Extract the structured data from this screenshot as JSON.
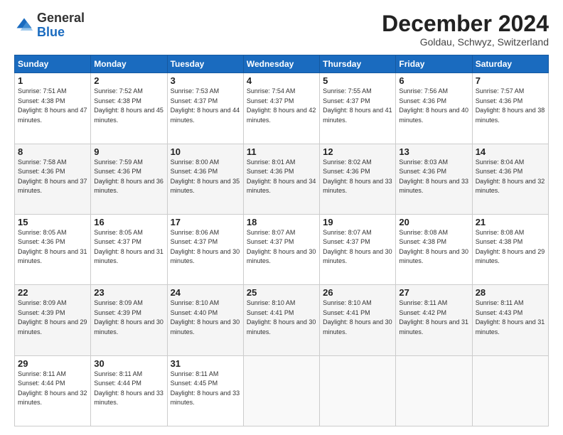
{
  "header": {
    "logo_general": "General",
    "logo_blue": "Blue",
    "main_title": "December 2024",
    "subtitle": "Goldau, Schwyz, Switzerland"
  },
  "days_of_week": [
    "Sunday",
    "Monday",
    "Tuesday",
    "Wednesday",
    "Thursday",
    "Friday",
    "Saturday"
  ],
  "weeks": [
    [
      {
        "day": "1",
        "sunrise": "Sunrise: 7:51 AM",
        "sunset": "Sunset: 4:38 PM",
        "daylight": "Daylight: 8 hours and 47 minutes."
      },
      {
        "day": "2",
        "sunrise": "Sunrise: 7:52 AM",
        "sunset": "Sunset: 4:38 PM",
        "daylight": "Daylight: 8 hours and 45 minutes."
      },
      {
        "day": "3",
        "sunrise": "Sunrise: 7:53 AM",
        "sunset": "Sunset: 4:37 PM",
        "daylight": "Daylight: 8 hours and 44 minutes."
      },
      {
        "day": "4",
        "sunrise": "Sunrise: 7:54 AM",
        "sunset": "Sunset: 4:37 PM",
        "daylight": "Daylight: 8 hours and 42 minutes."
      },
      {
        "day": "5",
        "sunrise": "Sunrise: 7:55 AM",
        "sunset": "Sunset: 4:37 PM",
        "daylight": "Daylight: 8 hours and 41 minutes."
      },
      {
        "day": "6",
        "sunrise": "Sunrise: 7:56 AM",
        "sunset": "Sunset: 4:36 PM",
        "daylight": "Daylight: 8 hours and 40 minutes."
      },
      {
        "day": "7",
        "sunrise": "Sunrise: 7:57 AM",
        "sunset": "Sunset: 4:36 PM",
        "daylight": "Daylight: 8 hours and 38 minutes."
      }
    ],
    [
      {
        "day": "8",
        "sunrise": "Sunrise: 7:58 AM",
        "sunset": "Sunset: 4:36 PM",
        "daylight": "Daylight: 8 hours and 37 minutes."
      },
      {
        "day": "9",
        "sunrise": "Sunrise: 7:59 AM",
        "sunset": "Sunset: 4:36 PM",
        "daylight": "Daylight: 8 hours and 36 minutes."
      },
      {
        "day": "10",
        "sunrise": "Sunrise: 8:00 AM",
        "sunset": "Sunset: 4:36 PM",
        "daylight": "Daylight: 8 hours and 35 minutes."
      },
      {
        "day": "11",
        "sunrise": "Sunrise: 8:01 AM",
        "sunset": "Sunset: 4:36 PM",
        "daylight": "Daylight: 8 hours and 34 minutes."
      },
      {
        "day": "12",
        "sunrise": "Sunrise: 8:02 AM",
        "sunset": "Sunset: 4:36 PM",
        "daylight": "Daylight: 8 hours and 33 minutes."
      },
      {
        "day": "13",
        "sunrise": "Sunrise: 8:03 AM",
        "sunset": "Sunset: 4:36 PM",
        "daylight": "Daylight: 8 hours and 33 minutes."
      },
      {
        "day": "14",
        "sunrise": "Sunrise: 8:04 AM",
        "sunset": "Sunset: 4:36 PM",
        "daylight": "Daylight: 8 hours and 32 minutes."
      }
    ],
    [
      {
        "day": "15",
        "sunrise": "Sunrise: 8:05 AM",
        "sunset": "Sunset: 4:36 PM",
        "daylight": "Daylight: 8 hours and 31 minutes."
      },
      {
        "day": "16",
        "sunrise": "Sunrise: 8:05 AM",
        "sunset": "Sunset: 4:37 PM",
        "daylight": "Daylight: 8 hours and 31 minutes."
      },
      {
        "day": "17",
        "sunrise": "Sunrise: 8:06 AM",
        "sunset": "Sunset: 4:37 PM",
        "daylight": "Daylight: 8 hours and 30 minutes."
      },
      {
        "day": "18",
        "sunrise": "Sunrise: 8:07 AM",
        "sunset": "Sunset: 4:37 PM",
        "daylight": "Daylight: 8 hours and 30 minutes."
      },
      {
        "day": "19",
        "sunrise": "Sunrise: 8:07 AM",
        "sunset": "Sunset: 4:37 PM",
        "daylight": "Daylight: 8 hours and 30 minutes."
      },
      {
        "day": "20",
        "sunrise": "Sunrise: 8:08 AM",
        "sunset": "Sunset: 4:38 PM",
        "daylight": "Daylight: 8 hours and 30 minutes."
      },
      {
        "day": "21",
        "sunrise": "Sunrise: 8:08 AM",
        "sunset": "Sunset: 4:38 PM",
        "daylight": "Daylight: 8 hours and 29 minutes."
      }
    ],
    [
      {
        "day": "22",
        "sunrise": "Sunrise: 8:09 AM",
        "sunset": "Sunset: 4:39 PM",
        "daylight": "Daylight: 8 hours and 29 minutes."
      },
      {
        "day": "23",
        "sunrise": "Sunrise: 8:09 AM",
        "sunset": "Sunset: 4:39 PM",
        "daylight": "Daylight: 8 hours and 30 minutes."
      },
      {
        "day": "24",
        "sunrise": "Sunrise: 8:10 AM",
        "sunset": "Sunset: 4:40 PM",
        "daylight": "Daylight: 8 hours and 30 minutes."
      },
      {
        "day": "25",
        "sunrise": "Sunrise: 8:10 AM",
        "sunset": "Sunset: 4:41 PM",
        "daylight": "Daylight: 8 hours and 30 minutes."
      },
      {
        "day": "26",
        "sunrise": "Sunrise: 8:10 AM",
        "sunset": "Sunset: 4:41 PM",
        "daylight": "Daylight: 8 hours and 30 minutes."
      },
      {
        "day": "27",
        "sunrise": "Sunrise: 8:11 AM",
        "sunset": "Sunset: 4:42 PM",
        "daylight": "Daylight: 8 hours and 31 minutes."
      },
      {
        "day": "28",
        "sunrise": "Sunrise: 8:11 AM",
        "sunset": "Sunset: 4:43 PM",
        "daylight": "Daylight: 8 hours and 31 minutes."
      }
    ],
    [
      {
        "day": "29",
        "sunrise": "Sunrise: 8:11 AM",
        "sunset": "Sunset: 4:44 PM",
        "daylight": "Daylight: 8 hours and 32 minutes."
      },
      {
        "day": "30",
        "sunrise": "Sunrise: 8:11 AM",
        "sunset": "Sunset: 4:44 PM",
        "daylight": "Daylight: 8 hours and 33 minutes."
      },
      {
        "day": "31",
        "sunrise": "Sunrise: 8:11 AM",
        "sunset": "Sunset: 4:45 PM",
        "daylight": "Daylight: 8 hours and 33 minutes."
      },
      null,
      null,
      null,
      null
    ]
  ]
}
